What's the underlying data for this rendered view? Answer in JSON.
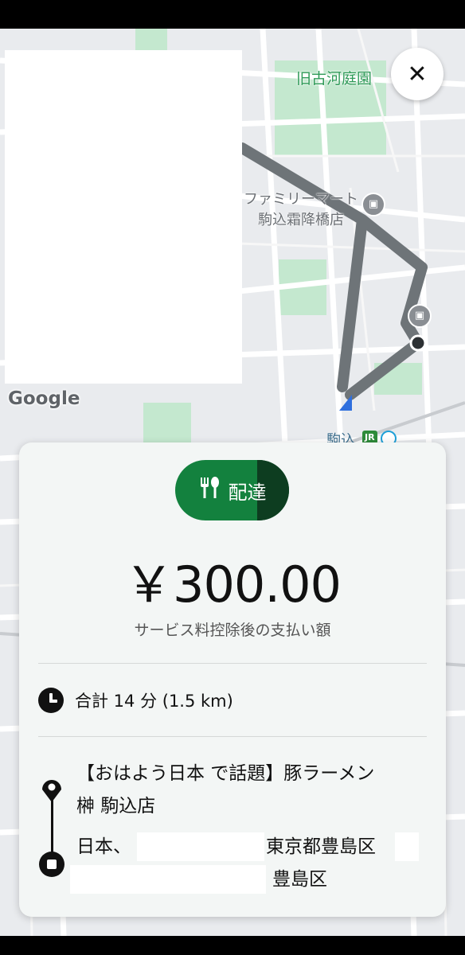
{
  "map": {
    "labels": {
      "park": "旧古河庭園",
      "store_line1": "ファミリーマート",
      "store_line2": "駒込霜降橋店",
      "station": "駒込"
    },
    "badges": {
      "jr": "JR"
    },
    "google_logo": "Google",
    "colors": {
      "route": "#6e7478",
      "green_area": "#c4e8cf",
      "road": "#ffffff",
      "location_arrow": "#2f6fde"
    }
  },
  "close_button": {
    "icon": "close-icon",
    "glyph": "✕"
  },
  "card": {
    "service_badge": {
      "icon": "fork-spoon-icon",
      "label": "配達",
      "progress": 0.28,
      "color": "#13813e",
      "progress_color": "#0d3d20"
    },
    "amount": "￥300.00",
    "amount_caption": "サービス料控除後の支払い額",
    "duration": {
      "icon": "clock-icon",
      "text": "合計 14 分 (1.5 km)"
    },
    "pickup": {
      "icon": "pin-icon",
      "name_line1": "【おはよう日本 で話題】豚ラーメン",
      "name_line2": "榊 駒込店"
    },
    "dropoff": {
      "icon": "stop-icon",
      "line1_prefix": "日本、",
      "line1_suffix": "東京都豊島区",
      "line2_suffix": "豊島区"
    }
  }
}
